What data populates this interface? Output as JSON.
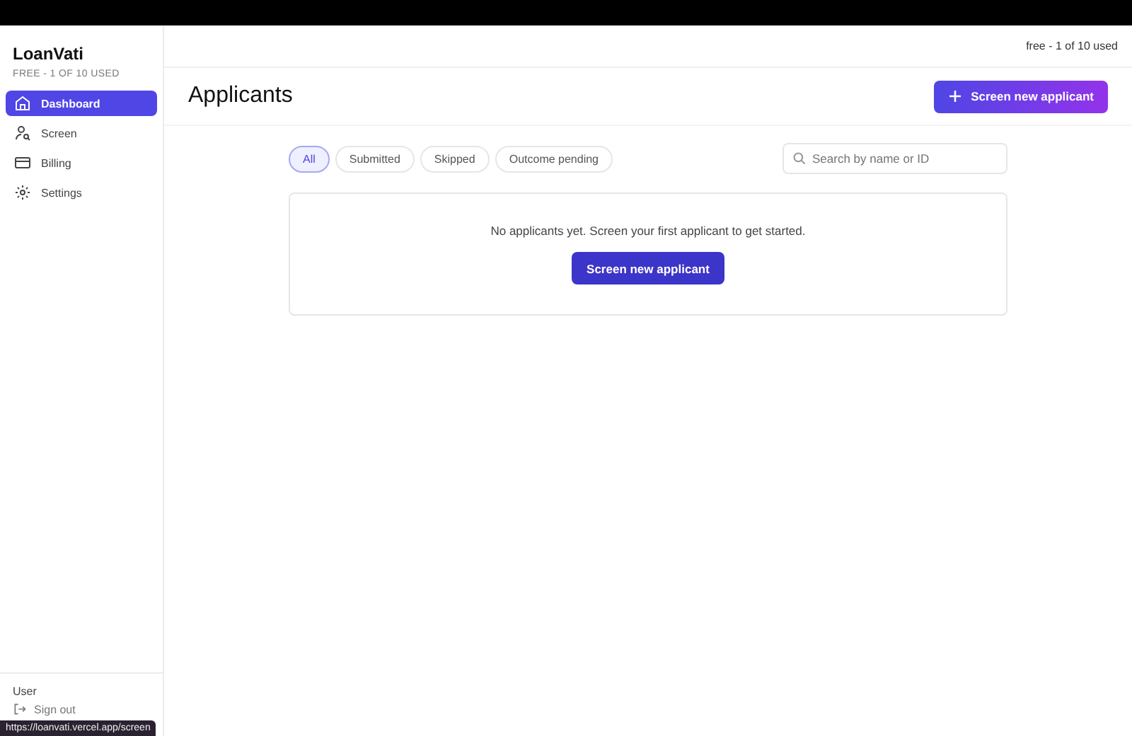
{
  "sidebar": {
    "brand": "LoanVati",
    "plan": "FREE - 1 OF 10 USED",
    "items": [
      {
        "label": "Dashboard",
        "kind": "home",
        "selected": true
      },
      {
        "label": "Screen",
        "kind": "user",
        "selected": false
      },
      {
        "label": "Billing",
        "kind": "card",
        "selected": false
      },
      {
        "label": "Settings",
        "kind": "gear",
        "selected": false
      }
    ],
    "user": "User",
    "sign_out": "Sign out"
  },
  "topbar": {
    "usage": "free - 1 of 10 used"
  },
  "header": {
    "title": "Applicants",
    "button": "Screen new applicant"
  },
  "filters": [
    {
      "label": "All",
      "selected": true
    },
    {
      "label": "Submitted",
      "selected": false
    },
    {
      "label": "Skipped",
      "selected": false
    },
    {
      "label": "Outcome pending",
      "selected": false
    }
  ],
  "search": {
    "placeholder": "Search by name or ID"
  },
  "empty": {
    "message": "No applicants yet. Screen your first applicant to get started.",
    "button": "Screen new applicant"
  },
  "status_url": "https://loanvati.vercel.app/screen"
}
